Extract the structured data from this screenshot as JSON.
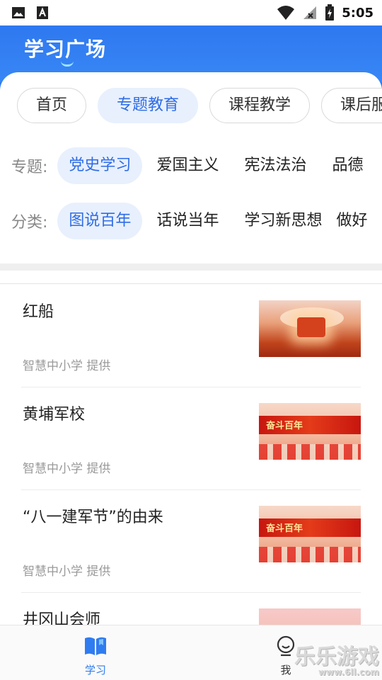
{
  "status_bar": {
    "time": "5:05"
  },
  "header": {
    "title": "学习广场"
  },
  "tabs": [
    {
      "label": "首页"
    },
    {
      "label": "专题教育"
    },
    {
      "label": "课程教学"
    },
    {
      "label": "课后服务"
    }
  ],
  "filters": {
    "topic": {
      "label": "专题:",
      "options": [
        "党史学习",
        "爱国主义",
        "宪法法治",
        "品德"
      ]
    },
    "category": {
      "label": "分类:",
      "options": [
        "图说百年",
        "话说当年",
        "学习新思想",
        "做好"
      ]
    }
  },
  "items": [
    {
      "title": "红船",
      "source": "智慧中小学 提供",
      "thumb_text": ""
    },
    {
      "title": "黄埔军校",
      "source": "智慧中小学 提供",
      "thumb_text": "奋斗百年"
    },
    {
      "title": "“八一建军节”的由来",
      "source": "智慧中小学 提供",
      "thumb_text": "奋斗百年"
    },
    {
      "title": "井冈山会师",
      "source": "",
      "thumb_text": ""
    }
  ],
  "bottom_tabs": [
    {
      "label": "学习",
      "icon": "book-icon",
      "active": true
    },
    {
      "label": "我",
      "icon": "user-icon",
      "active": false
    }
  ],
  "watermark": {
    "text": "乐乐游戏",
    "url": "www.6ll.com"
  },
  "colors": {
    "primary": "#2f7cf0",
    "active_tab_bg": "#e8f0fd",
    "active_tab_text": "#2f6de6"
  }
}
